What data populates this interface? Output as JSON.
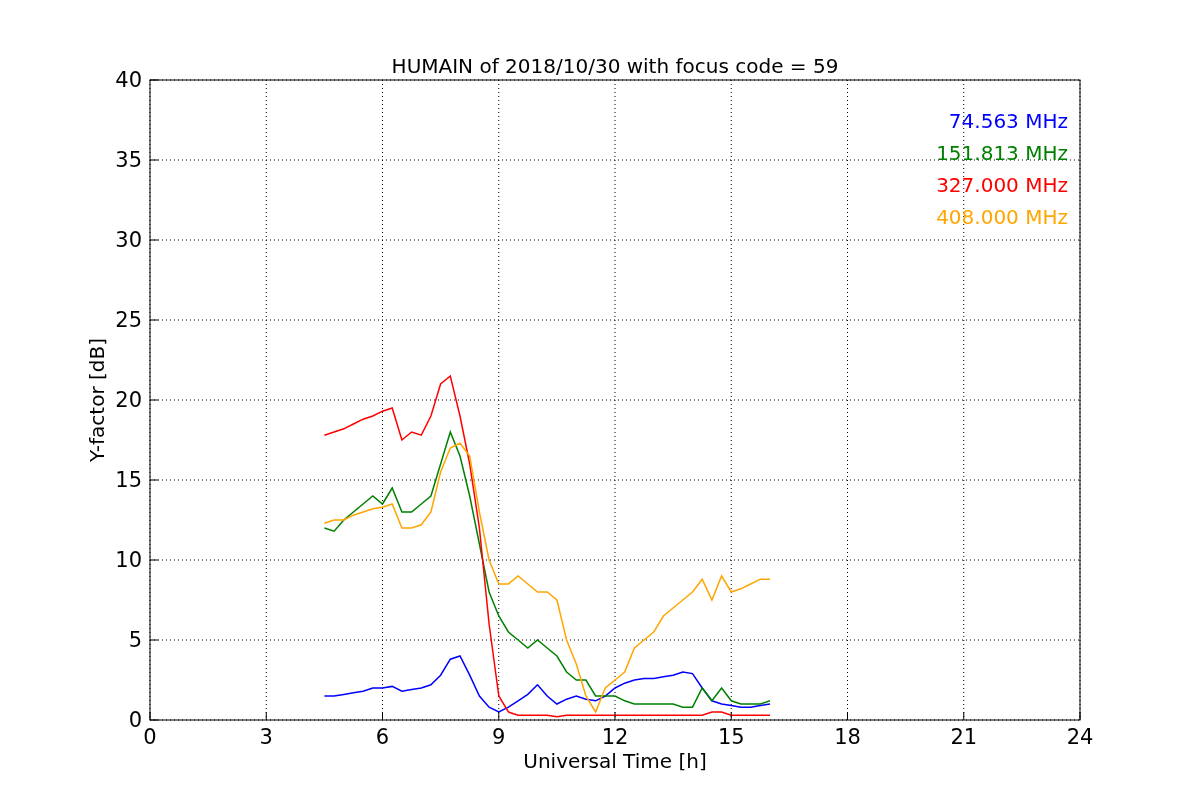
{
  "chart_data": {
    "type": "line",
    "title": "HUMAIN of 2018/10/30 with focus code = 59",
    "xlabel": "Universal Time [h]",
    "ylabel": "Y-factor [dB]",
    "x": [
      4.5,
      4.75,
      5,
      5.25,
      5.5,
      5.75,
      6,
      6.25,
      6.5,
      6.75,
      7,
      7.25,
      7.5,
      7.75,
      8,
      8.25,
      8.5,
      8.75,
      9,
      9.25,
      9.5,
      9.75,
      10,
      10.25,
      10.5,
      10.75,
      11,
      11.25,
      11.5,
      11.75,
      12,
      12.25,
      12.5,
      12.75,
      13,
      13.25,
      13.5,
      13.75,
      14,
      14.25,
      14.5,
      14.75,
      15,
      15.25,
      15.5,
      15.75,
      16
    ],
    "series": [
      {
        "name": "74.563 MHz",
        "color": "#0000ff",
        "values": [
          1.5,
          1.5,
          1.6,
          1.7,
          1.8,
          2.0,
          2.0,
          2.1,
          1.8,
          1.9,
          2.0,
          2.2,
          2.8,
          3.8,
          4.0,
          2.8,
          1.5,
          0.8,
          0.5,
          0.8,
          1.2,
          1.6,
          2.2,
          1.5,
          1.0,
          1.3,
          1.5,
          1.3,
          1.2,
          1.5,
          2.0,
          2.3,
          2.5,
          2.6,
          2.6,
          2.7,
          2.8,
          3.0,
          2.9,
          2.0,
          1.2,
          1.0,
          0.9,
          0.8,
          0.8,
          0.9,
          1.0
        ]
      },
      {
        "name": "151.813 MHz",
        "color": "#008000",
        "values": [
          12,
          11.8,
          12.5,
          13,
          13.5,
          14,
          13.5,
          14.5,
          13,
          13,
          13.5,
          14,
          16,
          18,
          16.5,
          14,
          11,
          8,
          6.5,
          5.5,
          5,
          4.5,
          5,
          4.5,
          4,
          3,
          2.5,
          2.5,
          1.5,
          1.5,
          1.5,
          1.2,
          1.0,
          1.0,
          1.0,
          1.0,
          1.0,
          0.8,
          0.8,
          2,
          1.2,
          2,
          1.2,
          1.0,
          1.0,
          1.0,
          1.2
        ]
      },
      {
        "name": "327.000 MHz",
        "color": "#ff0000",
        "values": [
          17.8,
          18,
          18.2,
          18.5,
          18.8,
          19,
          19.3,
          19.5,
          17.5,
          18,
          17.8,
          19,
          21,
          21.5,
          19,
          16,
          12,
          6,
          1.5,
          0.5,
          0.3,
          0.3,
          0.3,
          0.3,
          0.2,
          0.3,
          0.3,
          0.3,
          0.3,
          0.3,
          0.3,
          0.3,
          0.3,
          0.3,
          0.3,
          0.3,
          0.3,
          0.3,
          0.3,
          0.3,
          0.5,
          0.5,
          0.3,
          0.3,
          0.3,
          0.3,
          0.3
        ]
      },
      {
        "name": "408.000 MHz",
        "color": "#ffa500",
        "values": [
          12.3,
          12.5,
          12.5,
          12.8,
          13,
          13.2,
          13.3,
          13.5,
          12,
          12,
          12.2,
          13,
          15.5,
          17,
          17.3,
          16.5,
          13,
          10,
          8.5,
          8.5,
          9,
          8.5,
          8,
          8,
          7.5,
          5,
          3.5,
          1.5,
          0.5,
          2.0,
          2.5,
          3.0,
          4.5,
          5,
          5.5,
          6.5,
          7,
          7.5,
          8,
          8.8,
          7.5,
          9,
          8,
          8.2,
          8.5,
          8.8,
          8.8
        ]
      }
    ],
    "grid": true,
    "xlim": [
      0,
      24
    ],
    "ylim": [
      0,
      40
    ],
    "xticks": [
      0,
      3,
      6,
      9,
      12,
      15,
      18,
      21,
      24
    ],
    "yticks": [
      0,
      5,
      10,
      15,
      20,
      25,
      30,
      35,
      40
    ]
  }
}
